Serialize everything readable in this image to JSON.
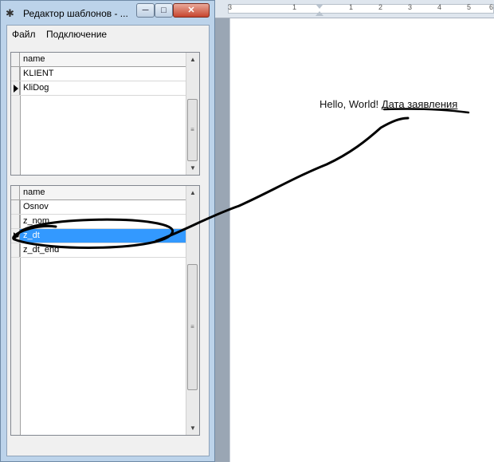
{
  "window": {
    "title": "Редактор шаблонов - ...",
    "buttons": {
      "minimize": "─",
      "maximize": "□",
      "close": "✕"
    },
    "icon": "tree-app-icon"
  },
  "menu": {
    "items": [
      "Файл",
      "Подключение"
    ]
  },
  "grid_top": {
    "header": "name",
    "rows": [
      "KLIENT",
      "KliDog"
    ],
    "current_row": 1
  },
  "grid_bottom": {
    "header": "name",
    "rows": [
      "Osnov",
      "z_nom",
      "z_dt",
      "z_dt_end"
    ],
    "current_row": 2,
    "selected_row": 2
  },
  "document": {
    "text": "Hello, World!",
    "field": "Дата заявления"
  },
  "ruler": {
    "labels": [
      "3",
      "1",
      "1",
      "2",
      "3",
      "4",
      "5",
      "6"
    ]
  },
  "colors": {
    "selection": "#3399ff",
    "window_frame": "#bcd3ea",
    "close_button": "#c6452e"
  }
}
